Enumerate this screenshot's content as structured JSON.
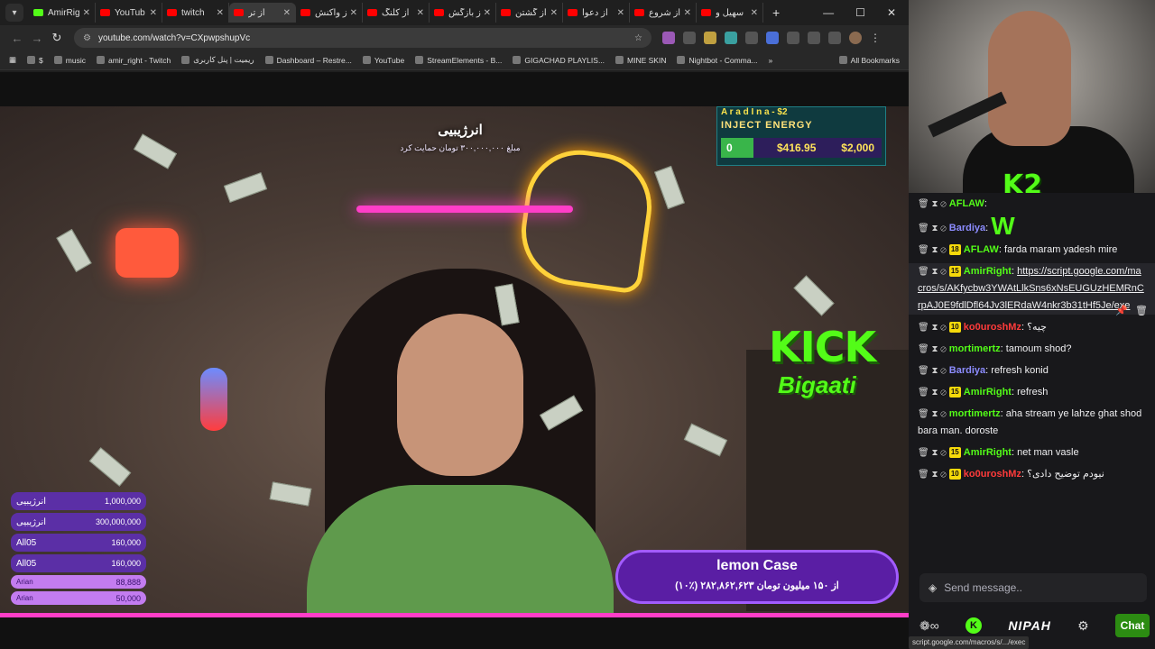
{
  "browser": {
    "tabs": [
      {
        "label": "AmirRig",
        "icon": "kick-icon",
        "active": false
      },
      {
        "label": "YouTub",
        "icon": "youtube-icon",
        "active": false
      },
      {
        "label": "twitch",
        "icon": "youtube-icon",
        "active": false
      },
      {
        "label": "از تر",
        "icon": "youtube-icon",
        "active": true
      },
      {
        "label": "از واکنش",
        "icon": "youtube-icon",
        "active": false
      },
      {
        "label": "از کلنگ",
        "icon": "youtube-icon",
        "active": false
      },
      {
        "label": "از بازگش",
        "icon": "youtube-icon",
        "active": false
      },
      {
        "label": "از گشتن",
        "icon": "youtube-icon",
        "active": false
      },
      {
        "label": "از دعوا",
        "icon": "youtube-icon",
        "active": false
      },
      {
        "label": "از شروع",
        "icon": "youtube-icon",
        "active": false
      },
      {
        "label": "سهیل و",
        "icon": "youtube-icon",
        "active": false
      }
    ],
    "url": "youtube.com/watch?v=CXpwpshupVc",
    "bookmarks": [
      "$",
      "music",
      "amir_right - Twitch",
      "ریمیت | پنل کاربری",
      "Dashboard – Restre...",
      "YouTube",
      "StreamElements - B...",
      "GIGACHAD PLAYLIS...",
      "MINE SKIN",
      "Nightbot - Comma..."
    ],
    "all_bookmarks": "All Bookmarks",
    "status_url": "script.google.com/macros/s/.../exec"
  },
  "stream": {
    "donation": {
      "title": "انرژیبیی",
      "subtitle": "مبلغ ۳۰۰,۰۰۰,۰۰۰ تومان حمایت کرد"
    },
    "inject": {
      "name": "A r a d  I n a  -  $2",
      "title": "INJECT ENERGY",
      "start": "0",
      "current": "$416.95",
      "goal": "$2,000"
    },
    "kick_text": "KICK",
    "kick_sub": "Bigaati",
    "leaderboard": [
      {
        "name": "انرژیبیی",
        "amount": "1,000,000"
      },
      {
        "name": "انرژیبیی",
        "amount": "300,000,000"
      },
      {
        "name": "All05",
        "amount": "160,000"
      },
      {
        "name": "All05",
        "amount": "160,000"
      },
      {
        "name": "Arian",
        "amount": "88,888"
      },
      {
        "name": "Arian",
        "amount": "50,000"
      }
    ],
    "progress": {
      "title": "lemon Case",
      "subtitle": "(۱۰٪) ۲۸۲,۸۶۲,۶۲۳ از ۱۵۰ میلیون تومان"
    }
  },
  "webcam": {
    "overlay_text": "K2"
  },
  "chat": {
    "messages": [
      {
        "badges": [],
        "user": "AFLAW",
        "user_color": "#53fc18",
        "text": ""
      },
      {
        "badges": [],
        "user": "Bardiya",
        "user_color": "#8c8cff",
        "text": "",
        "emote": "W"
      },
      {
        "badges": [
          "18"
        ],
        "user": "AFLAW",
        "user_color": "#53fc18",
        "text": "farda maram yadesh mire"
      },
      {
        "badges": [
          "15"
        ],
        "user": "AmirRight",
        "user_color": "#53fc18",
        "text": "https://script.google.com/macros/s/AKfycbw3YWAtLlkSns6xNsEUGUzHEMRnCrpAJ0E9fdlDfl64Jv3lERdaW4nkr3b31tHf5Je/exe"
      },
      {
        "badges": [
          "10"
        ],
        "user": "ko0uroshMz",
        "user_color": "#ff3b3b",
        "text": "چیه؟"
      },
      {
        "badges": [],
        "user": "mortimertz",
        "user_color": "#53fc18",
        "text": "tamoum shod?"
      },
      {
        "badges": [],
        "user": "Bardiya",
        "user_color": "#8c8cff",
        "text": "refresh konid"
      },
      {
        "badges": [
          "15"
        ],
        "user": "AmirRight",
        "user_color": "#53fc18",
        "text": "refresh"
      },
      {
        "badges": [],
        "user": "mortimertz",
        "user_color": "#53fc18",
        "text": "aha stream ye lahze ghat shod bara man. doroste"
      },
      {
        "badges": [
          "15"
        ],
        "user": "AmirRight",
        "user_color": "#53fc18",
        "text": "net man vasle"
      },
      {
        "badges": [
          "10"
        ],
        "user": "ko0uroshMz",
        "user_color": "#ff3b3b",
        "text": "نیودم توضیح دادی؟"
      }
    ],
    "input_placeholder": "Send message..",
    "footer_brand": "NIPAH",
    "chat_button": "Chat"
  }
}
